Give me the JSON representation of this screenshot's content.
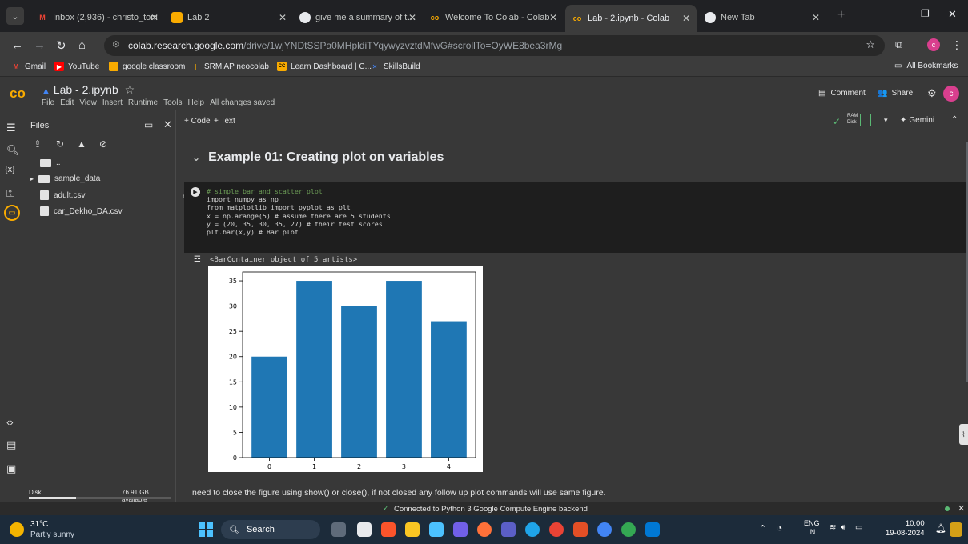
{
  "browser": {
    "tabs": [
      {
        "title": "Inbox (2,936) - christo_toni",
        "color": "#ea4335",
        "letter": "M"
      },
      {
        "title": "Lab 2",
        "color": "#f9ab00",
        "letter": ""
      },
      {
        "title": "give me a summary of the",
        "color": "#ffffff",
        "letter": ""
      },
      {
        "title": "Welcome To Colab - Colab",
        "color": "#f9ab00",
        "letter": "co"
      },
      {
        "title": "Lab - 2.ipynb - Colab",
        "color": "#f9ab00",
        "letter": "co"
      },
      {
        "title": "New Tab",
        "color": "#ffffff",
        "letter": ""
      }
    ],
    "url_host": "colab.research.google.com",
    "url_path": "/drive/1wjYNDtSSPa0MHpldiTYqywyzvztdMfwG#scrollTo=OyWE8bea3rMg",
    "bookmarks": [
      "Gmail",
      "YouTube",
      "google classroom",
      "SRM AP neocolab",
      "Learn Dashboard | C...",
      "SkillsBuild"
    ],
    "all_bookmarks": "All Bookmarks"
  },
  "colab": {
    "notebook_title": "Lab - 2.ipynb",
    "menu": [
      "File",
      "Edit",
      "View",
      "Insert",
      "Runtime",
      "Tools",
      "Help"
    ],
    "saved_status": "All changes saved",
    "comment": "Comment",
    "share": "Share",
    "avatar_letter": "c",
    "toolbar": {
      "add_code": "+ Code",
      "add_text": "+ Text",
      "ram": "RAM",
      "disk": "Disk",
      "gemini": "Gemini"
    }
  },
  "sidebar": {
    "title": "Files",
    "items": [
      "..",
      "sample_data",
      "adult.csv",
      "car_Dekho_DA.csv"
    ],
    "disk_label": "Disk",
    "disk_available": "76.91 GB available",
    "disk_usage_fraction": 0.33
  },
  "notebook": {
    "heading": "Example 01: Creating plot on variables",
    "exec_count": "1s",
    "code_lines": [
      "# simple bar and scatter plot",
      "import numpy as np",
      "from matplotlib import pyplot as plt",
      "x = np.arange(5) # assume there are 5 students",
      "y = (20, 35, 30, 35, 27) # their test scores",
      "plt.bar(x,y) # Bar plot"
    ],
    "output_text": "<BarContainer object of 5 artists>",
    "note": "need to close the figure using show() or close(), if not closed any follow up plot commands will use same figure."
  },
  "chart_data": {
    "type": "bar",
    "categories": [
      "0",
      "1",
      "2",
      "3",
      "4"
    ],
    "values": [
      20,
      35,
      30,
      35,
      27
    ],
    "ylim": [
      0,
      36.75
    ],
    "yticks": [
      0,
      5,
      10,
      15,
      20,
      25,
      30,
      35
    ],
    "bar_color": "#1f77b4",
    "grid": false
  },
  "status": {
    "connected": "Connected to Python 3 Google Compute Engine backend"
  },
  "taskbar": {
    "weather_temp": "31°C",
    "weather_desc": "Partly sunny",
    "search": "Search",
    "lang": "ENG",
    "region": "IN",
    "time": "10:00",
    "date": "19-08-2024"
  }
}
